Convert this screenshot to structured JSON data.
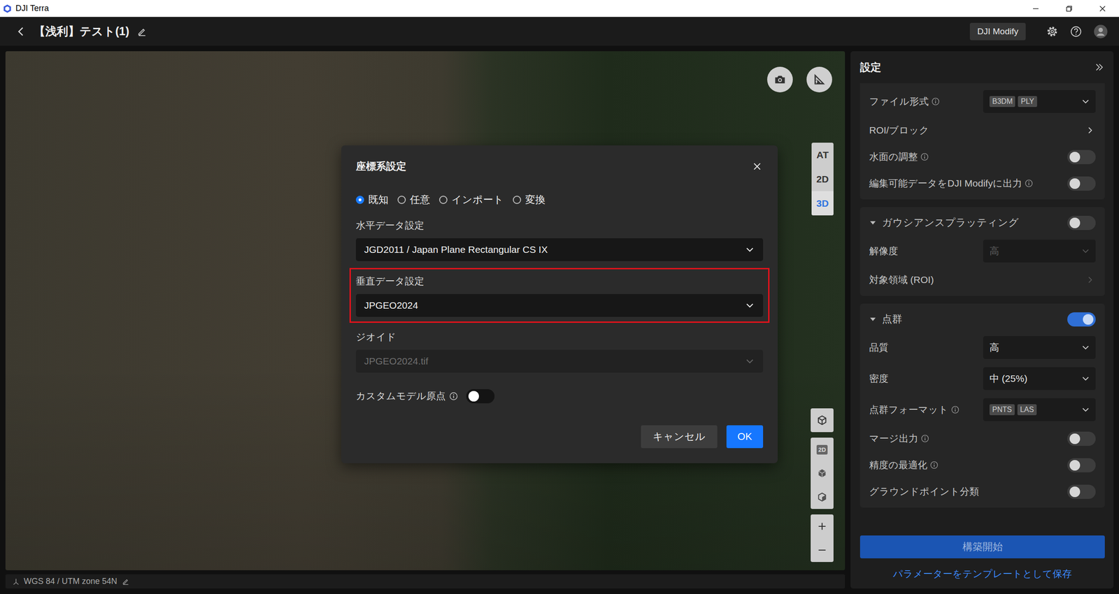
{
  "window": {
    "title": "DJI Terra"
  },
  "header": {
    "title": "【浅利】テスト(1)",
    "modify_button": "DJI Modify"
  },
  "map": {
    "view_modes": [
      {
        "label": "AT",
        "selected": false
      },
      {
        "label": "2D",
        "selected": false
      },
      {
        "label": "3D",
        "selected": true
      }
    ],
    "tool_badge": "2D"
  },
  "status_bar": {
    "crs": "WGS 84 / UTM zone 54N"
  },
  "panel": {
    "title": "設定",
    "groups": [
      {
        "header": null,
        "rows": [
          {
            "kind": "select",
            "label": "ファイル形式",
            "info": true,
            "tags": [
              "B3DM",
              "PLY"
            ],
            "value": "",
            "disabled": false
          },
          {
            "kind": "link",
            "label": "ROI/ブロック",
            "info": false,
            "disabled": false
          },
          {
            "kind": "toggle",
            "label": "水面の調整",
            "info": true,
            "on": false
          },
          {
            "kind": "toggle",
            "label": "編集可能データをDJI Modifyに出力",
            "info": true,
            "on": false
          }
        ]
      },
      {
        "header": {
          "label": "ガウシアンスプラッティング",
          "expanded": true,
          "on": false
        },
        "rows": [
          {
            "kind": "select",
            "label": "解像度",
            "info": false,
            "tags": [],
            "value": "高",
            "disabled": true
          },
          {
            "kind": "link",
            "label": "対象領域 (ROI)",
            "info": false,
            "disabled": true
          }
        ]
      },
      {
        "header": {
          "label": "点群",
          "expanded": true,
          "on": true
        },
        "rows": [
          {
            "kind": "select",
            "label": "品質",
            "info": false,
            "tags": [],
            "value": "高",
            "disabled": false
          },
          {
            "kind": "select",
            "label": "密度",
            "info": false,
            "tags": [],
            "value": "中 (25%)",
            "disabled": false
          },
          {
            "kind": "select",
            "label": "点群フォーマット",
            "info": true,
            "tags": [
              "PNTS",
              "LAS"
            ],
            "value": "",
            "disabled": false
          },
          {
            "kind": "toggle",
            "label": "マージ出力",
            "info": true,
            "on": false
          },
          {
            "kind": "toggle",
            "label": "精度の最適化",
            "info": true,
            "on": false
          },
          {
            "kind": "toggle",
            "label": "グラウンドポイント分類",
            "info": false,
            "on": false
          }
        ]
      }
    ],
    "build_button": {
      "label": "構築開始",
      "disabled": true
    },
    "save_template": "パラメーターをテンプレートとして保存"
  },
  "dialog": {
    "title": "座標系設定",
    "modes": [
      {
        "label": "既知",
        "selected": true
      },
      {
        "label": "任意",
        "selected": false
      },
      {
        "label": "インポート",
        "selected": false
      },
      {
        "label": "変換",
        "selected": false
      }
    ],
    "fields": [
      {
        "label": "水平データ設定",
        "value": "JGD2011 / Japan Plane Rectangular CS IX",
        "disabled": false,
        "highlighted": false
      },
      {
        "label": "垂直データ設定",
        "value": "JPGEO2024",
        "disabled": false,
        "highlighted": true
      },
      {
        "label": "ジオイド",
        "value": "JPGEO2024.tif",
        "disabled": true,
        "highlighted": false
      }
    ],
    "custom_origin": {
      "label": "カスタムモデル原点",
      "info": true,
      "on": false
    },
    "buttons": [
      {
        "label": "キャンセル",
        "primary": false
      },
      {
        "label": "OK",
        "primary": true
      }
    ]
  }
}
